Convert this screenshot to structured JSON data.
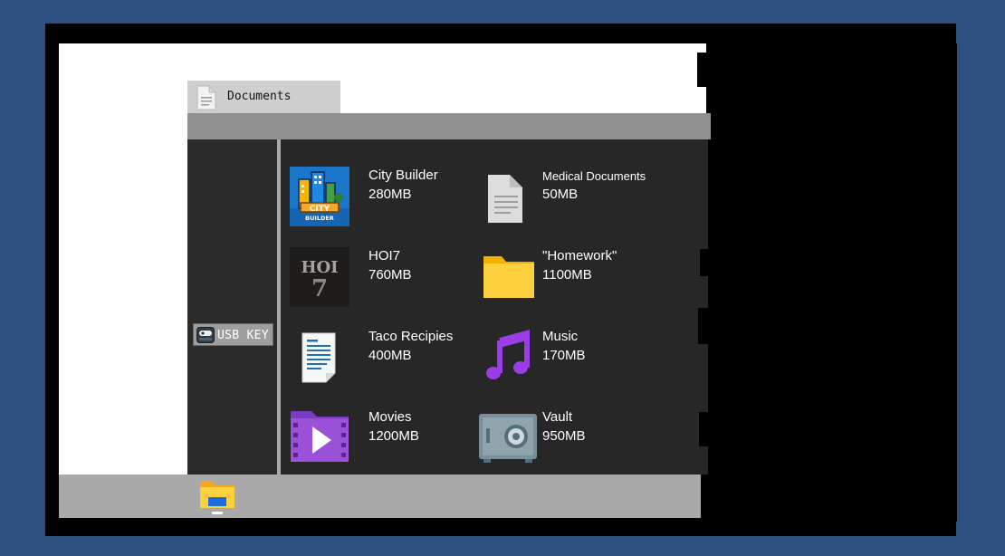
{
  "window": {
    "tab_title": "Documents",
    "tab_icon": "document-icon"
  },
  "sidebar": {
    "drive_label": "USB KEY",
    "drive_icon": "usb-drive-icon"
  },
  "files": [
    {
      "name": "City Builder",
      "size": "280MB",
      "icon": "city-builder-icon"
    },
    {
      "name": "Medical Documents",
      "size": "50MB",
      "icon": "document-icon"
    },
    {
      "name": "HOI7",
      "size": "760MB",
      "icon": "hoi7-icon"
    },
    {
      "name": "\"Homework\"",
      "size": "1100MB",
      "icon": "folder-icon"
    },
    {
      "name": "Taco Recipies",
      "size": "400MB",
      "icon": "text-document-icon"
    },
    {
      "name": "Music",
      "size": "170MB",
      "icon": "music-note-icon"
    },
    {
      "name": "Movies",
      "size": "1200MB",
      "icon": "movie-folder-icon"
    },
    {
      "name": "Vault",
      "size": "950MB",
      "icon": "safe-icon"
    }
  ],
  "taskbar": {
    "app_icon": "file-explorer-icon"
  },
  "colors": {
    "desktop": "#2e5080",
    "panel": "#272727",
    "folder": "#fcd03e",
    "music": "#9b3de6",
    "movies": "#9b52d9"
  }
}
